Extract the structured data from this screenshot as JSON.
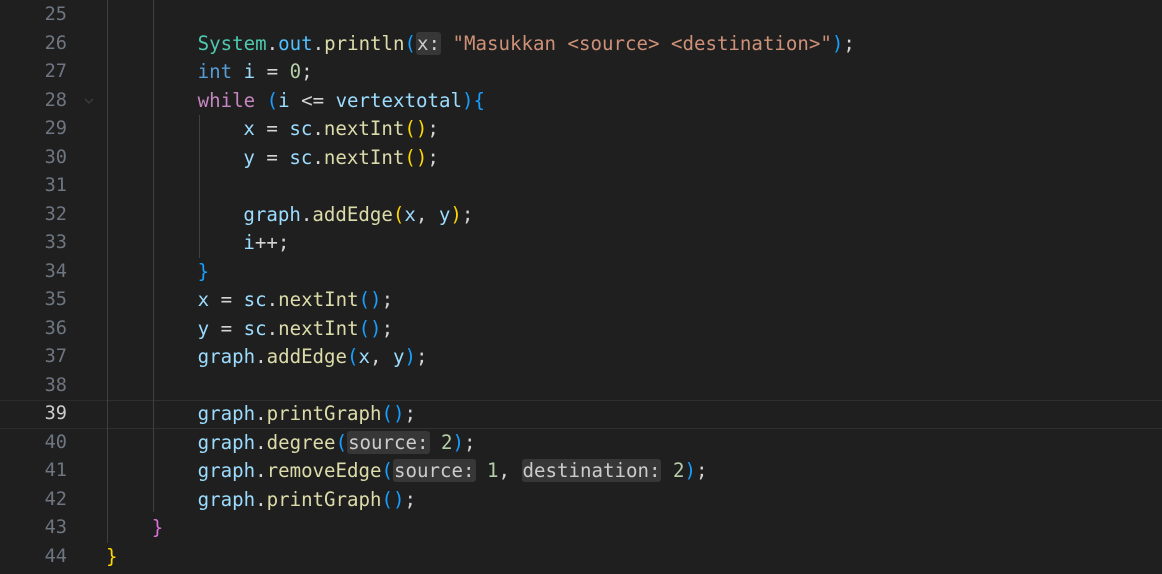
{
  "editor": {
    "language": "java",
    "current_line": "39",
    "lines": [
      {
        "n": "25",
        "tokens": []
      },
      {
        "n": "26",
        "tokens": [
          {
            "t": "System",
            "c": "cls"
          },
          {
            "t": ".",
            "c": "op"
          },
          {
            "t": "out",
            "c": "fld"
          },
          {
            "t": ".",
            "c": "op"
          },
          {
            "t": "println",
            "c": "fn"
          },
          {
            "t": "(",
            "c": "b3"
          },
          {
            "t": "x:",
            "c": "hint"
          },
          {
            "t": "\"Masukkan <source> <destination>\"",
            "c": "str"
          },
          {
            "t": ")",
            "c": "b3"
          },
          {
            "t": ";",
            "c": "op"
          }
        ]
      },
      {
        "n": "27",
        "tokens": [
          {
            "t": "int",
            "c": "kw"
          },
          {
            "t": " ",
            "c": "op"
          },
          {
            "t": "i",
            "c": "var"
          },
          {
            "t": " = ",
            "c": "op"
          },
          {
            "t": "0",
            "c": "num"
          },
          {
            "t": ";",
            "c": "op"
          }
        ]
      },
      {
        "n": "28",
        "tokens": [
          {
            "t": "while",
            "c": "ctl"
          },
          {
            "t": " ",
            "c": "op"
          },
          {
            "t": "(",
            "c": "b3"
          },
          {
            "t": "i",
            "c": "var"
          },
          {
            "t": " <= ",
            "c": "op"
          },
          {
            "t": "vertextotal",
            "c": "var"
          },
          {
            "t": ")",
            "c": "b3"
          },
          {
            "t": "{",
            "c": "b3"
          }
        ]
      },
      {
        "n": "29",
        "tokens": [
          {
            "t": "x",
            "c": "var"
          },
          {
            "t": " = ",
            "c": "op"
          },
          {
            "t": "sc",
            "c": "var"
          },
          {
            "t": ".",
            "c": "op"
          },
          {
            "t": "nextInt",
            "c": "fn"
          },
          {
            "t": "()",
            "c": "b1"
          },
          {
            "t": ";",
            "c": "op"
          }
        ]
      },
      {
        "n": "30",
        "tokens": [
          {
            "t": "y",
            "c": "var"
          },
          {
            "t": " = ",
            "c": "op"
          },
          {
            "t": "sc",
            "c": "var"
          },
          {
            "t": ".",
            "c": "op"
          },
          {
            "t": "nextInt",
            "c": "fn"
          },
          {
            "t": "()",
            "c": "b1"
          },
          {
            "t": ";",
            "c": "op"
          }
        ]
      },
      {
        "n": "31",
        "tokens": []
      },
      {
        "n": "32",
        "tokens": [
          {
            "t": "graph",
            "c": "var"
          },
          {
            "t": ".",
            "c": "op"
          },
          {
            "t": "addEdge",
            "c": "fn"
          },
          {
            "t": "(",
            "c": "b1"
          },
          {
            "t": "x",
            "c": "var"
          },
          {
            "t": ", ",
            "c": "op"
          },
          {
            "t": "y",
            "c": "var"
          },
          {
            "t": ")",
            "c": "b1"
          },
          {
            "t": ";",
            "c": "op"
          }
        ]
      },
      {
        "n": "33",
        "tokens": [
          {
            "t": "i",
            "c": "var"
          },
          {
            "t": "++;",
            "c": "op"
          }
        ]
      },
      {
        "n": "34",
        "tokens": [
          {
            "t": "}",
            "c": "b3"
          }
        ]
      },
      {
        "n": "35",
        "tokens": [
          {
            "t": "x",
            "c": "var"
          },
          {
            "t": " = ",
            "c": "op"
          },
          {
            "t": "sc",
            "c": "var"
          },
          {
            "t": ".",
            "c": "op"
          },
          {
            "t": "nextInt",
            "c": "fn"
          },
          {
            "t": "()",
            "c": "b3"
          },
          {
            "t": ";",
            "c": "op"
          }
        ]
      },
      {
        "n": "36",
        "tokens": [
          {
            "t": "y",
            "c": "var"
          },
          {
            "t": " = ",
            "c": "op"
          },
          {
            "t": "sc",
            "c": "var"
          },
          {
            "t": ".",
            "c": "op"
          },
          {
            "t": "nextInt",
            "c": "fn"
          },
          {
            "t": "()",
            "c": "b3"
          },
          {
            "t": ";",
            "c": "op"
          }
        ]
      },
      {
        "n": "37",
        "tokens": [
          {
            "t": "graph",
            "c": "var"
          },
          {
            "t": ".",
            "c": "op"
          },
          {
            "t": "addEdge",
            "c": "fn"
          },
          {
            "t": "(",
            "c": "b3"
          },
          {
            "t": "x",
            "c": "var"
          },
          {
            "t": ", ",
            "c": "op"
          },
          {
            "t": "y",
            "c": "var"
          },
          {
            "t": ")",
            "c": "b3"
          },
          {
            "t": ";",
            "c": "op"
          }
        ]
      },
      {
        "n": "38",
        "tokens": []
      },
      {
        "n": "39",
        "tokens": [
          {
            "t": "graph",
            "c": "var"
          },
          {
            "t": ".",
            "c": "op"
          },
          {
            "t": "printGraph",
            "c": "fn"
          },
          {
            "t": "()",
            "c": "b3"
          },
          {
            "t": ";",
            "c": "op"
          }
        ]
      },
      {
        "n": "40",
        "tokens": [
          {
            "t": "graph",
            "c": "var"
          },
          {
            "t": ".",
            "c": "op"
          },
          {
            "t": "degree",
            "c": "fn"
          },
          {
            "t": "(",
            "c": "b3"
          },
          {
            "t": "source:",
            "c": "hint"
          },
          {
            "t": "2",
            "c": "num"
          },
          {
            "t": ")",
            "c": "b3"
          },
          {
            "t": ";",
            "c": "op"
          }
        ]
      },
      {
        "n": "41",
        "tokens": [
          {
            "t": "graph",
            "c": "var"
          },
          {
            "t": ".",
            "c": "op"
          },
          {
            "t": "removeEdge",
            "c": "fn"
          },
          {
            "t": "(",
            "c": "b3"
          },
          {
            "t": "source:",
            "c": "hint"
          },
          {
            "t": "1",
            "c": "num"
          },
          {
            "t": ", ",
            "c": "op"
          },
          {
            "t": "destination:",
            "c": "hint"
          },
          {
            "t": "2",
            "c": "num"
          },
          {
            "t": ")",
            "c": "b3"
          },
          {
            "t": ";",
            "c": "op"
          }
        ]
      },
      {
        "n": "42",
        "tokens": [
          {
            "t": "graph",
            "c": "var"
          },
          {
            "t": ".",
            "c": "op"
          },
          {
            "t": "printGraph",
            "c": "fn"
          },
          {
            "t": "()",
            "c": "b3"
          },
          {
            "t": ";",
            "c": "op"
          }
        ]
      },
      {
        "n": "43",
        "tokens": [
          {
            "t": "}",
            "c": "b2"
          }
        ]
      },
      {
        "n": "44",
        "tokens": [
          {
            "t": "}",
            "c": "b1"
          }
        ]
      }
    ]
  }
}
